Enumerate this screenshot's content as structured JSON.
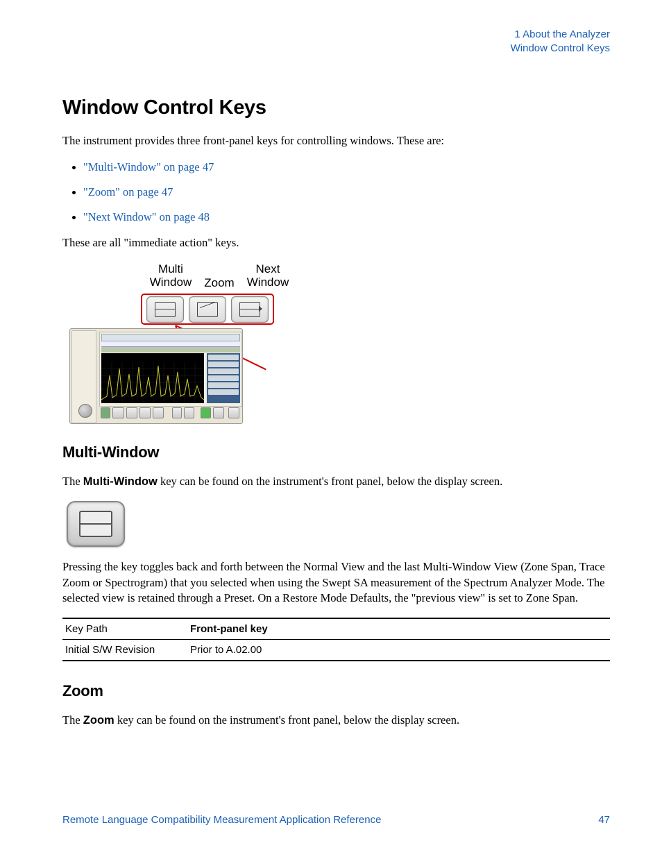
{
  "header": {
    "chapter": "1  About the Analyzer",
    "section": "Window Control Keys"
  },
  "h1": "Window Control Keys",
  "intro": "The instrument provides three front-panel keys for controlling windows. These are:",
  "links": [
    "\"Multi-Window\" on page 47",
    "\"Zoom\" on page 47",
    "\"Next Window\" on page 48"
  ],
  "post_list": "These are all \"immediate action\" keys.",
  "key_labels": {
    "multi_l1": "Multi",
    "multi_l2": "Window",
    "zoom": "Zoom",
    "next_l1": "Next",
    "next_l2": "Window"
  },
  "section_multiwindow": {
    "title": "Multi-Window",
    "p1_pre": "The ",
    "p1_bold": "Multi-Window",
    "p1_post": " key can be found on the instrument's front panel, below the display screen.",
    "p2": "Pressing the key toggles back and forth between the Normal View and the last Multi-Window View (Zone Span, Trace Zoom or Spectrogram) that you selected when using the Swept SA measurement of the Spectrum Analyzer Mode.  The selected view is retained through a Preset.  On a Restore Mode Defaults, the \"previous view\" is set to Zone Span.",
    "table": [
      {
        "k": "Key Path",
        "v": "Front-panel key",
        "vbold": true
      },
      {
        "k": "Initial S/W Revision",
        "v": "Prior to A.02.00",
        "vbold": false
      }
    ]
  },
  "section_zoom": {
    "title": "Zoom",
    "p1_pre": "The ",
    "p1_bold": "Zoom",
    "p1_post": "  key can be found on the instrument's front panel, below the display screen."
  },
  "footer": {
    "doc": "Remote Language Compatibility Measurement Application Reference",
    "page": "47"
  }
}
